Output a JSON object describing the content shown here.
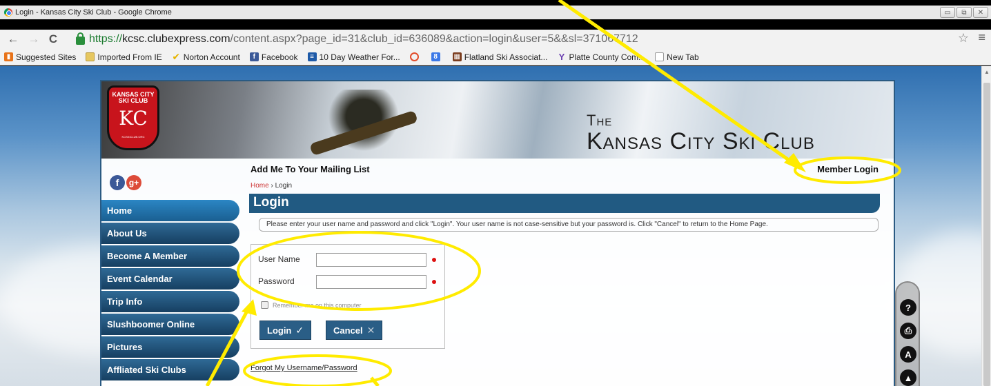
{
  "window": {
    "title": "Login - Kansas City Ski Club - Google Chrome",
    "buttons": [
      "▭",
      "⧉",
      "✕"
    ]
  },
  "toolbar": {
    "back": "←",
    "forward": "→",
    "reload": "C",
    "url_https": "https://",
    "url_host": "kcsc.clubexpress.com",
    "url_rest": "/content.aspx?page_id=31&club_id=636089&action=login&user=5&&sl=371067712",
    "star": "☆",
    "menu": "≡"
  },
  "bookmarks": [
    {
      "label": "Suggested Sites",
      "icon": "suggested-icon",
      "color": "#e8731a"
    },
    {
      "label": "Imported From IE",
      "icon": "folder-icon",
      "color": "#e6c760"
    },
    {
      "label": "Norton Account",
      "icon": "check-icon",
      "color": "#f2c200"
    },
    {
      "label": "Facebook",
      "icon": "facebook-icon",
      "color": "#3b5998"
    },
    {
      "label": "10 Day Weather For...",
      "icon": "weather-icon",
      "color": "#1e5aa8"
    },
    {
      "label": "",
      "icon": "loading-icon",
      "color": "#e24c2a"
    },
    {
      "label": "",
      "icon": "google-icon",
      "color": "#3b78e7"
    },
    {
      "label": "Flatland Ski Associat...",
      "icon": "flatland-icon",
      "color": "#7a3b1c"
    },
    {
      "label": "Platte County Com...",
      "icon": "platte-icon",
      "color": "#6a3fb0"
    },
    {
      "label": "New Tab",
      "icon": "page-icon",
      "color": "#ffffff"
    }
  ],
  "site": {
    "logo_top": "KANSAS CITY SKI CLUB",
    "logo_mono": "KC",
    "logo_url": "KCSKICLUB.ORG",
    "banner_the": "The",
    "banner_name": "Kansas City Ski Club",
    "mailing_link": "Add Me To Your Mailing List",
    "member_login": "Member Login",
    "breadcrumb_home": "Home",
    "breadcrumb_sep": "›",
    "breadcrumb_current": "Login",
    "page_title": "Login",
    "notice": "Please enter your user name and password and click \"Login\". Your user name is not case-sensitive but your password is. Click \"Cancel\" to return to the Home Page.",
    "social": {
      "facebook": "f",
      "googleplus": "g+"
    }
  },
  "nav": [
    {
      "label": "Home",
      "active": true
    },
    {
      "label": "About Us",
      "active": false
    },
    {
      "label": "Become A Member",
      "active": false
    },
    {
      "label": "Event Calendar",
      "active": false
    },
    {
      "label": "Trip Info",
      "active": false
    },
    {
      "label": "Slushboomer Online",
      "active": false
    },
    {
      "label": "Pictures",
      "active": false
    },
    {
      "label": "Affliated Ski Clubs",
      "active": false
    }
  ],
  "login": {
    "username_label": "User Name",
    "username_value": "",
    "password_label": "Password",
    "password_value": "",
    "remember_label": "Remember me on this computer",
    "login_button": "Login",
    "login_icon": "✓",
    "cancel_button": "Cancel",
    "cancel_icon": "✕",
    "forgot_link": "Forgot My Username/Password"
  },
  "tools": [
    {
      "icon": "help-icon",
      "glyph": "?"
    },
    {
      "icon": "print-icon",
      "glyph": "⎙"
    },
    {
      "icon": "text-size-icon",
      "glyph": "A"
    },
    {
      "icon": "top-icon",
      "glyph": "▲"
    }
  ],
  "annotation_color": "#ffeb00"
}
